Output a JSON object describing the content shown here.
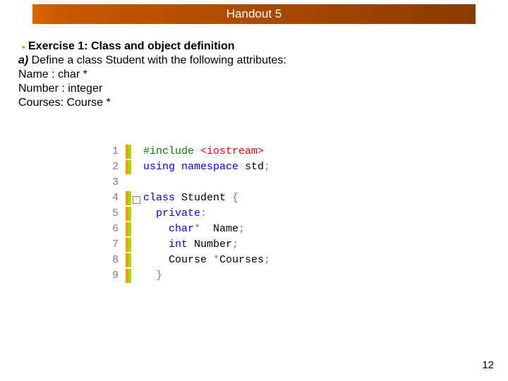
{
  "title": "Handout 5",
  "exercise": {
    "heading": "Exercise 1: Class and object definition",
    "part_label": "a)",
    "part_text": " Define a class Student with the following attributes:",
    "attrs": [
      "Name : char *",
      "Number : integer",
      "Courses: Course *"
    ]
  },
  "code": {
    "lines": [
      {
        "n": "1",
        "marks": "og",
        "fold": "",
        "tokens": [
          [
            "kw-green",
            "#include "
          ],
          [
            "tok-red",
            "<iostream>"
          ]
        ]
      },
      {
        "n": "2",
        "marks": "og",
        "fold": "",
        "tokens": [
          [
            "kw-blue",
            "using namespace"
          ],
          [
            "code-txt",
            " std"
          ],
          [
            "tok-gray",
            ";"
          ]
        ]
      },
      {
        "n": "3",
        "marks": "",
        "fold": "",
        "tokens": [
          [
            "code-txt",
            ""
          ]
        ]
      },
      {
        "n": "4",
        "marks": "og",
        "fold": "-",
        "tokens": [
          [
            "kw-blue",
            "class"
          ],
          [
            "code-txt",
            " Student "
          ],
          [
            "tok-gray",
            "{"
          ]
        ]
      },
      {
        "n": "5",
        "marks": "og",
        "fold": "",
        "tokens": [
          [
            "code-txt",
            "  "
          ],
          [
            "kw-blue",
            "private"
          ],
          [
            "tok-gray",
            ":"
          ]
        ]
      },
      {
        "n": "6",
        "marks": "og",
        "fold": "",
        "tokens": [
          [
            "code-txt",
            "    "
          ],
          [
            "kw-blue",
            "char"
          ],
          [
            "tok-gray",
            "*"
          ],
          [
            "code-txt",
            "  Name"
          ],
          [
            "tok-gray",
            ";"
          ]
        ]
      },
      {
        "n": "7",
        "marks": "og",
        "fold": "",
        "tokens": [
          [
            "code-txt",
            "    "
          ],
          [
            "kw-blue",
            "int"
          ],
          [
            "code-txt",
            " Number"
          ],
          [
            "tok-gray",
            ";"
          ]
        ]
      },
      {
        "n": "8",
        "marks": "og",
        "fold": "",
        "tokens": [
          [
            "code-txt",
            "    Course "
          ],
          [
            "tok-gray",
            "*"
          ],
          [
            "code-txt",
            "Courses"
          ],
          [
            "tok-gray",
            ";"
          ]
        ]
      },
      {
        "n": "9",
        "marks": "og",
        "fold": "",
        "tokens": [
          [
            "code-txt",
            "  "
          ],
          [
            "tok-gray",
            "}"
          ]
        ]
      }
    ]
  },
  "page_number": "12"
}
